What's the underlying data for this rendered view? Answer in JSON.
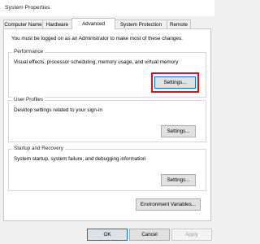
{
  "window": {
    "title": "System Properties"
  },
  "tabs": [
    {
      "label": "Computer Name"
    },
    {
      "label": "Hardware"
    },
    {
      "label": "Advanced"
    },
    {
      "label": "System Protection"
    },
    {
      "label": "Remote"
    }
  ],
  "notice": "You must be logged on as an Administrator to make most of these changes.",
  "groups": {
    "performance": {
      "label": "Performance",
      "description": "Visual effects, processor scheduling, memory usage, and virtual memory",
      "button": "Settings..."
    },
    "user_profiles": {
      "label": "User Profiles",
      "description": "Desktop settings related to your sign-in",
      "button": "Settings..."
    },
    "startup_recovery": {
      "label": "Startup and Recovery",
      "description": "System startup, system failure, and debugging information",
      "button": "Settings..."
    }
  },
  "environment_button": "Environment Variables...",
  "footer": {
    "ok": "OK",
    "cancel": "Cancel",
    "apply": "Apply"
  },
  "colors": {
    "highlight": "#d9122b",
    "focus_border": "#0078d7"
  }
}
